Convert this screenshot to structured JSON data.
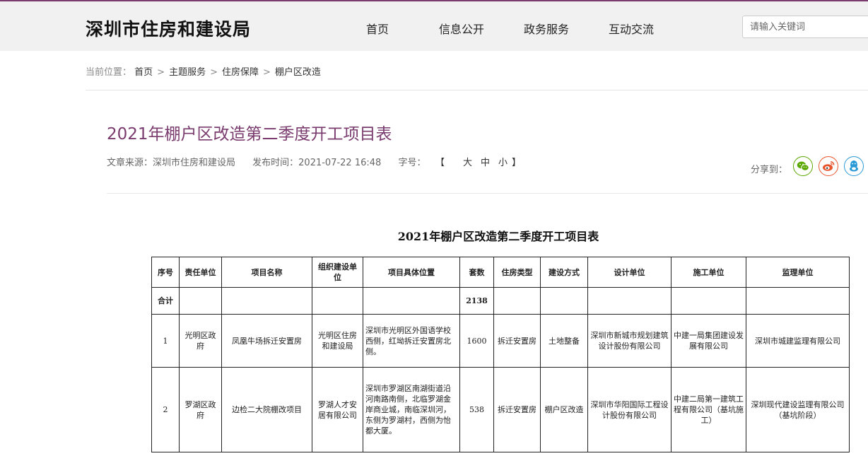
{
  "header": {
    "site_title": "深圳市住房和建设局",
    "nav": [
      "首页",
      "信息公开",
      "政务服务",
      "互动交流"
    ],
    "search_placeholder": "请输入关键词"
  },
  "breadcrumb": {
    "prefix": "当前位置：",
    "items": [
      "首页",
      "主题服务",
      "住房保障",
      "棚户区改造"
    ],
    "separator": ">"
  },
  "article": {
    "title": "2021年棚户区改造第二季度开工项目表",
    "source": "文章来源：深圳市住房和建设局",
    "publish_time": "发布时间：2021-07-22 16:48",
    "font_label": "字号：",
    "font_open": "【",
    "font_sizes": [
      "大",
      "中",
      "小"
    ],
    "font_close": "】"
  },
  "share": {
    "label": "分享到："
  },
  "colors": {
    "accent": "#7a3b6e",
    "wechat": "#5aa700",
    "weibo": "#e8552c",
    "qq": "#2a9ad6"
  },
  "document": {
    "title": "2021年棚户区改造第二季度开工项目表",
    "headers": [
      "序号",
      "责任单位",
      "项目名称",
      "组织建设单位",
      "项目具体位置",
      "套数",
      "住房类型",
      "建设方式",
      "设计单位",
      "施工单位",
      "监理单位"
    ],
    "total_row": [
      "合计",
      "",
      "",
      "",
      "",
      "2138",
      "",
      "",
      "",
      "",
      ""
    ],
    "rows": [
      [
        "1",
        "光明区政府",
        "凤凰牛场拆迁安置房",
        "光明区住房和建设局",
        "深圳市光明区外国语学校西侧，红坳拆迁安置房北侧。",
        "1600",
        "拆迁安置房",
        "土地整备",
        "深圳市新城市规划建筑设计股份有限公司",
        "中建一局集团建设发展有限公司",
        "深圳市城建监理有限公司"
      ],
      [
        "2",
        "罗湖区政府",
        "边检二大院棚改项目",
        "罗湖人才安居有限公司",
        "深圳市罗湖区南湖街道沿河南路南侧，北临罗湖金岸商业城，南临深圳河，东侧为罗湖村，西侧为怡都大厦。",
        "538",
        "拆迁安置房",
        "棚户区改造",
        "深圳市华阳国际工程设计股份有限公司",
        "中建二局第一建筑工程有限公司（基坑施工）",
        "深圳现代建设监理有限公司（基坑阶段）"
      ]
    ]
  }
}
